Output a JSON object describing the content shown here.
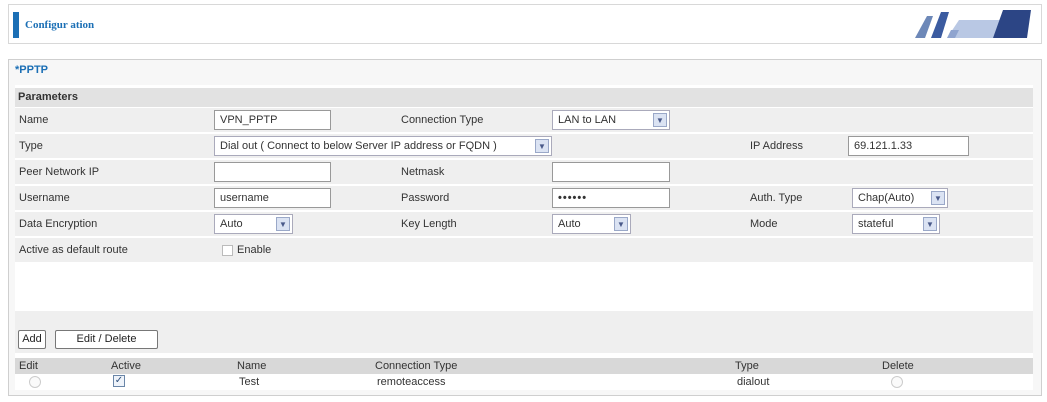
{
  "header": {
    "title": "Configur ation"
  },
  "panel": {
    "title": "*PPTP",
    "section": "Parameters"
  },
  "form": {
    "name_label": "Name",
    "name_value": "VPN_PPTP",
    "conn_type_label": "Connection Type",
    "conn_type_value": "LAN to LAN",
    "type_label": "Type",
    "type_value": "Dial out ( Connect to below Server IP address or FQDN )",
    "ip_label": "IP Address",
    "ip_value": "69.121.1.33",
    "peer_label": "Peer Network IP",
    "peer_value": "",
    "netmask_label": "Netmask",
    "netmask_value": "",
    "username_label": "Username",
    "username_value": "username",
    "password_label": "Password",
    "password_value": "••••••",
    "auth_label": "Auth. Type",
    "auth_value": "Chap(Auto)",
    "enc_label": "Data Encryption",
    "enc_value": "Auto",
    "keylen_label": "Key Length",
    "keylen_value": "Auto",
    "mode_label": "Mode",
    "mode_value": "stateful",
    "default_route_label": "Active as default route",
    "enable_label": "Enable"
  },
  "buttons": {
    "add": "Add",
    "edit_delete": "Edit / Delete"
  },
  "table": {
    "headers": [
      "Edit",
      "Active",
      "Name",
      "Connection Type",
      "Type",
      "Delete"
    ],
    "rows": [
      {
        "active": true,
        "name": "Test",
        "connection_type": "remoteaccess",
        "type": "dialout"
      }
    ]
  },
  "colors": {
    "accent": "#1b6fb5",
    "row_bg": "#efefef",
    "header_bg": "#d8d8d8"
  },
  "icons": {
    "dropdown": "chevron-down-icon",
    "checked": "check-icon"
  }
}
